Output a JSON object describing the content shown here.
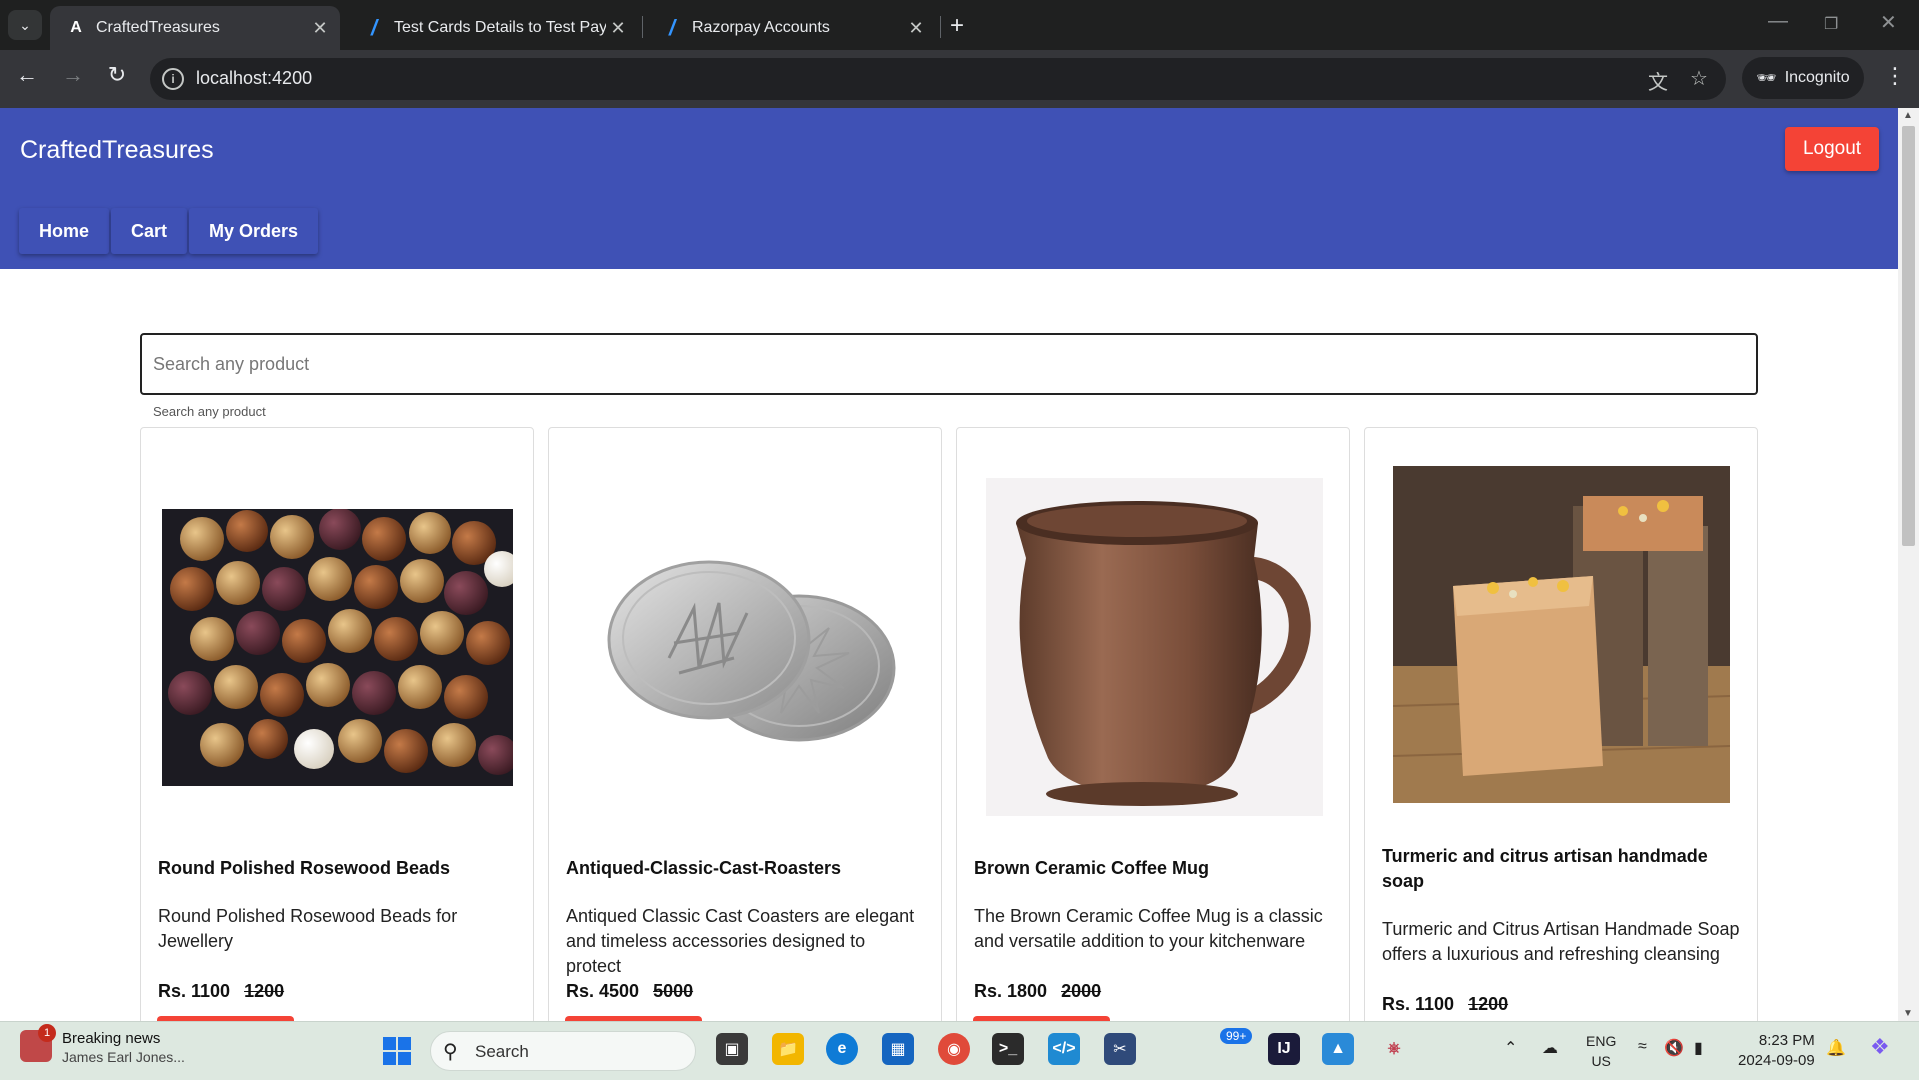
{
  "browser": {
    "tabs": [
      {
        "title": "CraftedTreasures",
        "favicon": "angular-icon",
        "active": true
      },
      {
        "title": "Test Cards Details to Test Payme",
        "favicon": "razorpay-icon",
        "active": false
      },
      {
        "title": "Razorpay Accounts",
        "favicon": "razorpay-icon",
        "active": false
      }
    ],
    "url": "localhost:4200",
    "incognito_label": "Incognito"
  },
  "app": {
    "brand": "CraftedTreasures",
    "logout_label": "Logout",
    "nav": [
      {
        "label": "Home"
      },
      {
        "label": "Cart"
      },
      {
        "label": "My Orders"
      }
    ],
    "search": {
      "placeholder": "Search any product",
      "hint": "Search any product"
    },
    "products": [
      {
        "name": "Round Polished Rosewood Beads",
        "description": "Round Polished Rosewood Beads for Jewellery",
        "price": "Rs. 1100",
        "original_price": "1200",
        "image": "wooden-beads-image"
      },
      {
        "name": "Antiqued-Classic-Cast-Roasters",
        "description": "Antiqued Classic Cast Coasters are elegant and timeless accessories designed to protect",
        "price": "Rs. 4500",
        "original_price": "5000",
        "image": "metal-coasters-image"
      },
      {
        "name": "Brown Ceramic Coffee Mug",
        "description": "The Brown Ceramic Coffee Mug is a classic and versatile addition to your kitchenware",
        "price": "Rs. 1800",
        "original_price": "2000",
        "image": "ceramic-mug-image"
      },
      {
        "name": "Turmeric and citrus artisan handmade soap",
        "description": "Turmeric and Citrus Artisan Handmade Soap offers a luxurious and refreshing cleansing",
        "price": "Rs. 1100",
        "original_price": "1200",
        "image": "handmade-soap-image"
      }
    ],
    "colors": {
      "primary": "#3f51b5",
      "warn": "#f44336"
    }
  },
  "taskbar": {
    "news_title": "Breaking news",
    "news_subtitle": "James Earl Jones...",
    "news_badge": "1",
    "search_label": "Search",
    "notification_badge": "99+",
    "lang_line1": "ENG",
    "lang_line2": "US",
    "time": "8:23 PM",
    "date": "2024-09-09"
  }
}
